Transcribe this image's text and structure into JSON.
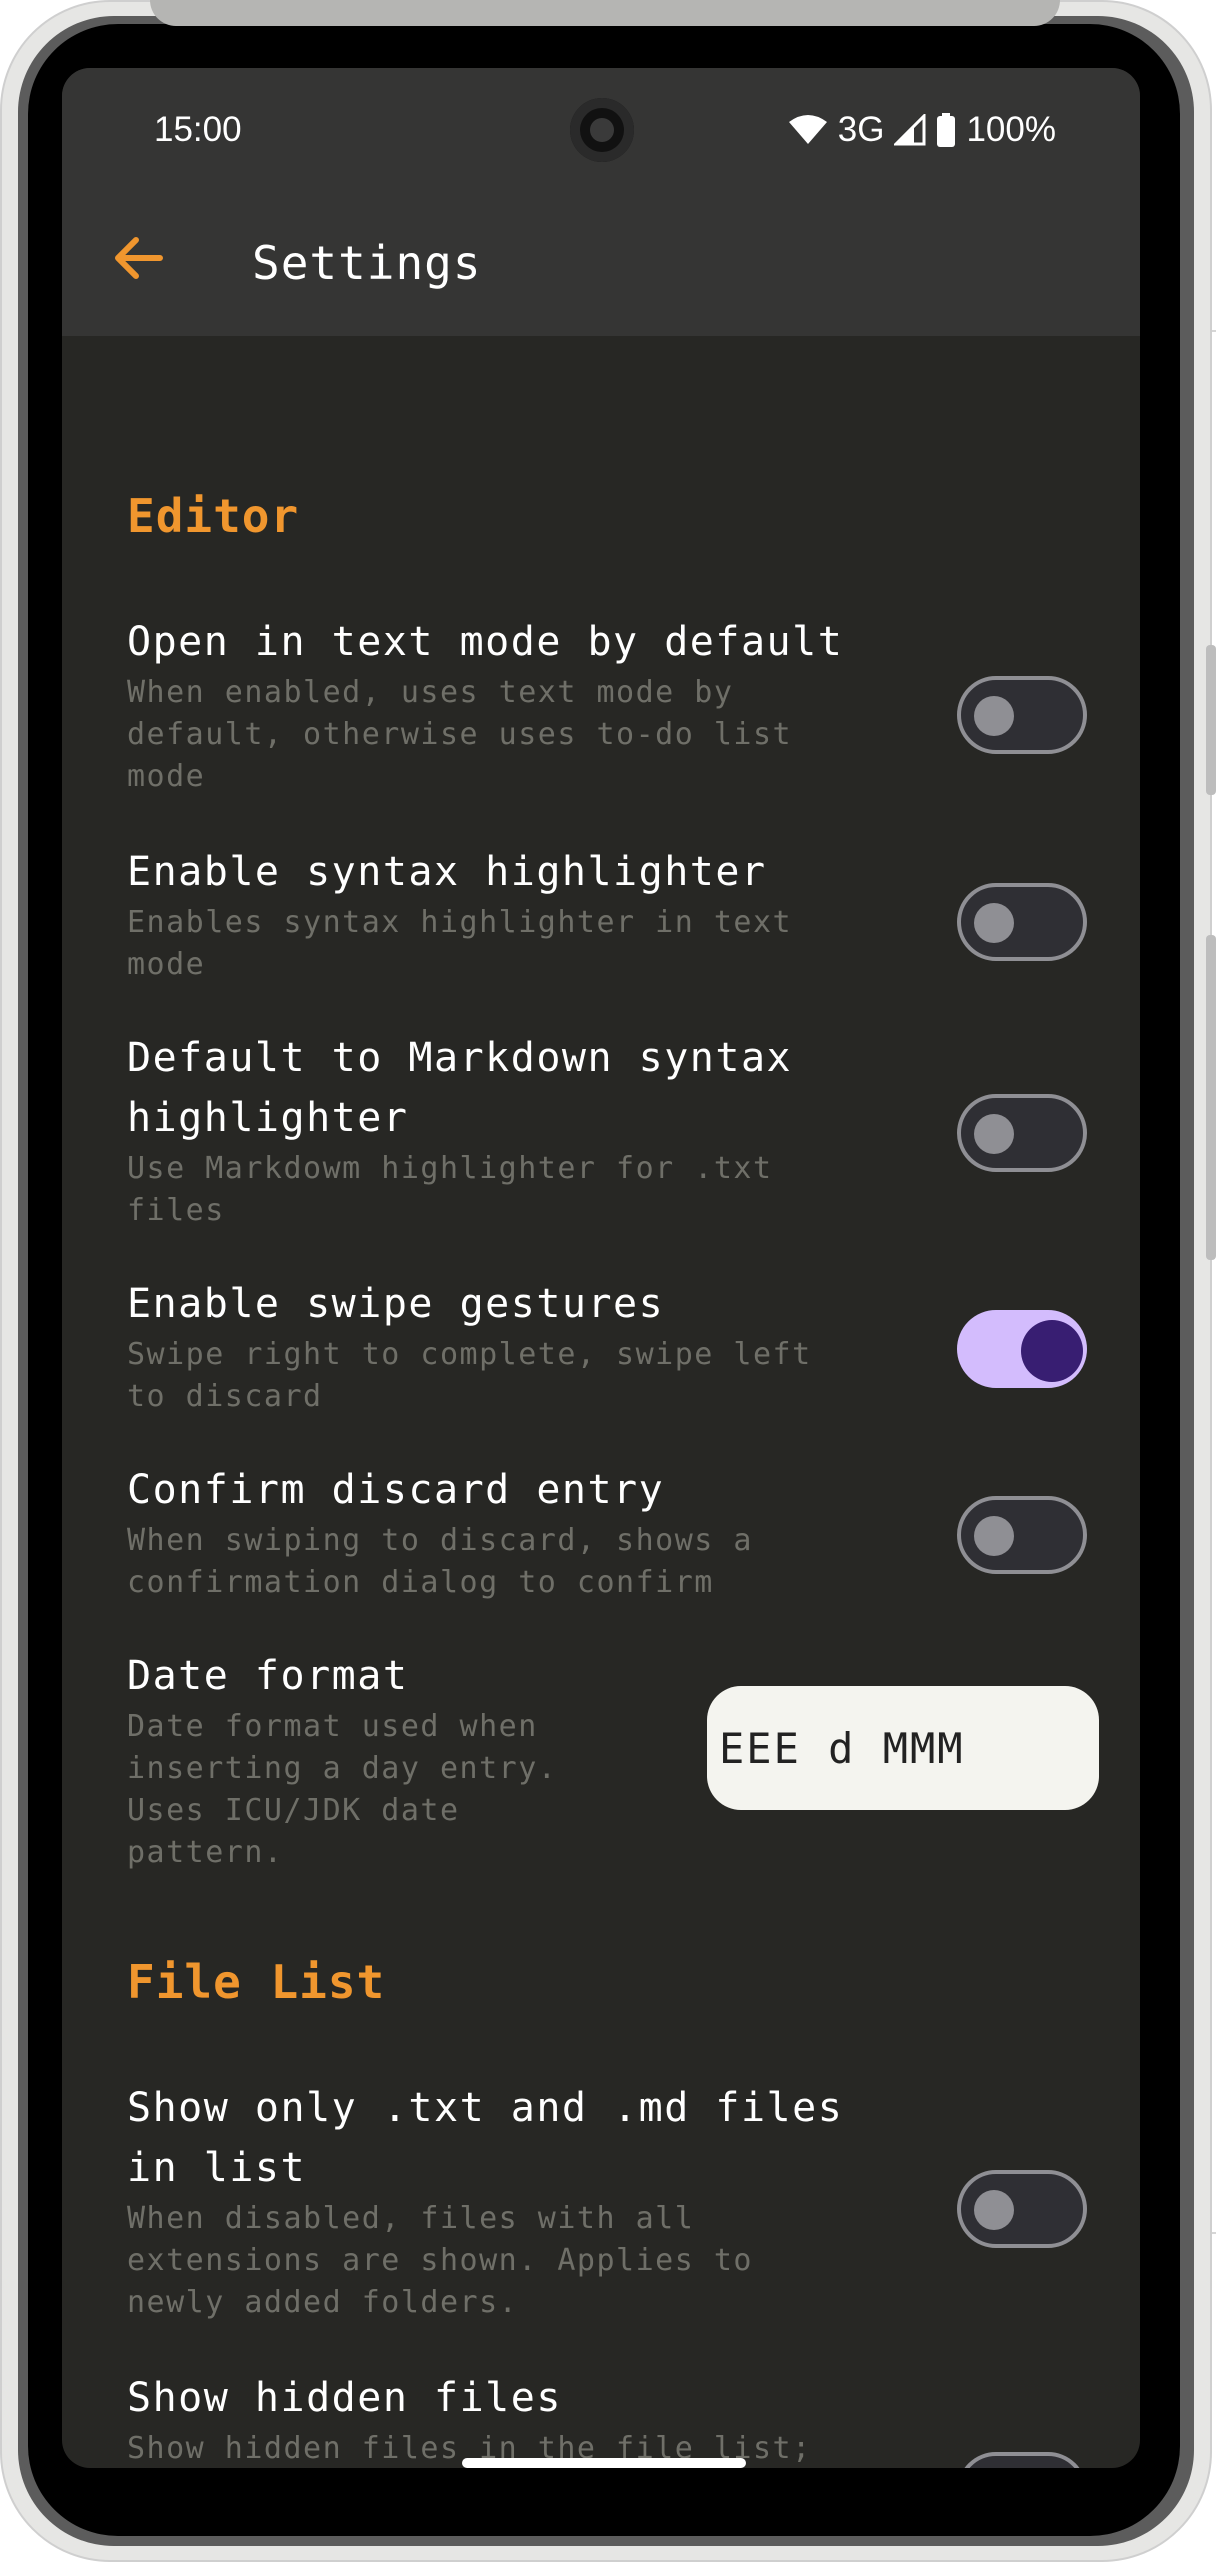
{
  "status_bar": {
    "time": "15:00",
    "network": "3G",
    "battery": "100%"
  },
  "appbar": {
    "title": "Settings"
  },
  "sections": [
    {
      "header": "Editor",
      "items": [
        {
          "title": "Open in text mode by default",
          "description": "When enabled, uses text mode by default, otherwise uses to-do list mode",
          "toggle": false
        },
        {
          "title": "Enable syntax highlighter",
          "description": "Enables syntax highlighter in text mode",
          "toggle": false
        },
        {
          "title": "Default to Markdown syntax highlighter",
          "description": "Use Markdowm highlighter for .txt files",
          "toggle": false
        },
        {
          "title": "Enable swipe gestures",
          "description": "Swipe right to complete, swipe left to discard",
          "toggle": true
        },
        {
          "title": "Confirm discard entry",
          "description": "When swiping to discard, shows a confirmation dialog to confirm",
          "toggle": false
        },
        {
          "title": "Date format",
          "description": "Date format used when inserting a day entry. Uses ICU/JDK date pattern.",
          "value": "EEE d MMM"
        }
      ]
    },
    {
      "header": "File List",
      "items": [
        {
          "title": "Show only .txt and .md files in list",
          "description": "When disabled, files with all extensions are shown. Applies to newly added folders.",
          "toggle": false
        },
        {
          "title": "Show hidden files",
          "description": "Show hidden files in the file list; only active when all files are",
          "toggle": false
        }
      ]
    }
  ],
  "colors": {
    "accent": "#f0962e",
    "background": "#272724",
    "appbar": "#353534",
    "toggle_on_track": "#d3bcfd",
    "toggle_on_knob": "#381e72"
  }
}
